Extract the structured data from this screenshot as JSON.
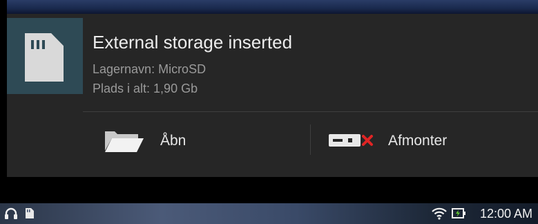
{
  "notification": {
    "title": "External storage inserted",
    "storage_name": "Lagernavn: MicroSD",
    "total_size": "Plads i alt: 1,90 Gb",
    "icon": "sd-card-icon",
    "actions": [
      {
        "label": "Åbn",
        "icon": "folder-icon"
      },
      {
        "label": "Afmonter",
        "icon": "unmount-icon"
      }
    ]
  },
  "status_bar": {
    "time": "12:00 AM",
    "left_icons": [
      "headphones-icon",
      "sd-card-small-icon"
    ],
    "right_icons": [
      "wifi-icon",
      "battery-charging-icon"
    ]
  },
  "colors": {
    "notification_bg": "#262626",
    "icon_panel_bg": "#2e4a55",
    "unmount_x": "#e02424"
  }
}
